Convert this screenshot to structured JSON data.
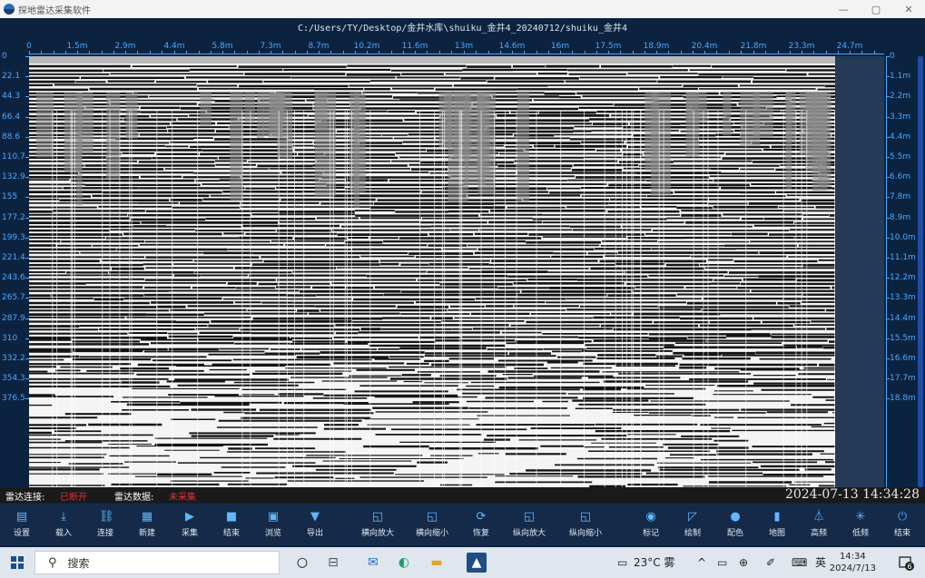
{
  "window": {
    "title": "探地雷达采集软件",
    "controls": [
      "—",
      "▢",
      "✕"
    ]
  },
  "file_path": "C:/Users/TY/Desktop/金井水库\\shuiku_金井4_20240712/shuiku_金井4",
  "x_axis": {
    "ticks": [
      "0",
      "1.5m",
      "2.9m",
      "4.4m",
      "5.8m",
      "7.3m",
      "8.7m",
      "10.2m",
      "11.6m",
      "13m",
      "14.6m",
      "16m",
      "17.5m",
      "18.9m",
      "20.4m",
      "21.8m",
      "23.3m",
      "24.7m"
    ]
  },
  "y_axis_left": {
    "ticks": [
      "0",
      "22.1",
      "44.3",
      "66.4",
      "88.6",
      "110.7",
      "132.9",
      "155",
      "177.2",
      "199.3",
      "221.4",
      "243.6",
      "265.7",
      "287.9",
      "310",
      "332.2",
      "354.3",
      "376.5"
    ]
  },
  "y_axis_right": {
    "ticks": [
      "0",
      "1.1m",
      "2.2m",
      "3.3m",
      "4.4m",
      "5.5m",
      "6.6m",
      "7.8m",
      "8.9m",
      "10.0m",
      "11.1m",
      "12.2m",
      "13.3m",
      "14.4m",
      "15.5m",
      "16.6m",
      "17.7m",
      "18.8m"
    ]
  },
  "status": {
    "radar_connect_label": "雷达连接:",
    "radar_connect_value": "已断开",
    "radar_data_label": "雷达数据:",
    "radar_data_value": "未采集",
    "datetime": "2024-07-13 14:34:28",
    "value_color": "#e03030"
  },
  "toolbar": [
    {
      "label": "设置",
      "icon": "settings-icon"
    },
    {
      "label": "载入",
      "icon": "download-icon"
    },
    {
      "label": "连接",
      "icon": "link-icon"
    },
    {
      "label": "新建",
      "icon": "new-file-icon"
    },
    {
      "label": "采集",
      "icon": "play-icon"
    },
    {
      "label": "结束",
      "icon": "stop-icon"
    },
    {
      "label": "浏览",
      "icon": "browse-icon"
    },
    {
      "label": "导出",
      "icon": "export-icon"
    },
    {
      "label": "横向放大",
      "icon": "h-zoom-in-icon"
    },
    {
      "label": "横向缩小",
      "icon": "h-zoom-out-icon"
    },
    {
      "label": "恢复",
      "icon": "refresh-icon"
    },
    {
      "label": "纵向放大",
      "icon": "v-zoom-in-icon"
    },
    {
      "label": "纵向缩小",
      "icon": "v-zoom-out-icon"
    },
    {
      "label": "标记",
      "icon": "marker-icon"
    },
    {
      "label": "绘制",
      "icon": "draw-icon"
    },
    {
      "label": "配色",
      "icon": "palette-icon"
    },
    {
      "label": "地图",
      "icon": "map-icon"
    },
    {
      "label": "高频",
      "icon": "high-freq-icon"
    },
    {
      "label": "低频",
      "icon": "low-freq-icon"
    },
    {
      "label": "结束",
      "icon": "power-icon"
    }
  ],
  "taskbar": {
    "search_placeholder": "搜索",
    "weather": "23°C 雾",
    "ime": "英",
    "time": "14:34",
    "date": "2024/7/13",
    "notifications": "6"
  },
  "colors": {
    "accent": "#4aa8ff",
    "background": "#0c2340",
    "toolbar": "#152a48",
    "icon": "#5fb7ff"
  }
}
